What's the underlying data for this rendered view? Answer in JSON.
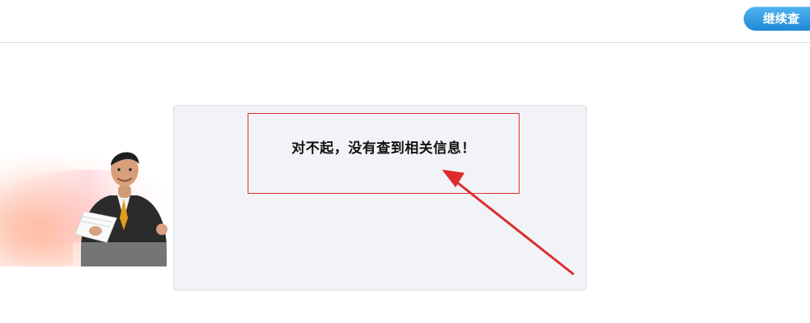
{
  "header": {
    "continue_label": "继续查"
  },
  "result": {
    "message": "对不起，没有查到相关信息！"
  },
  "colors": {
    "accent_blue": "#1f89d6",
    "panel_bg": "#f2f3f7",
    "annotation_red": "#e02b2b"
  },
  "icons": {
    "mascot": "businessman-illustration",
    "annotation": "red-arrow"
  }
}
